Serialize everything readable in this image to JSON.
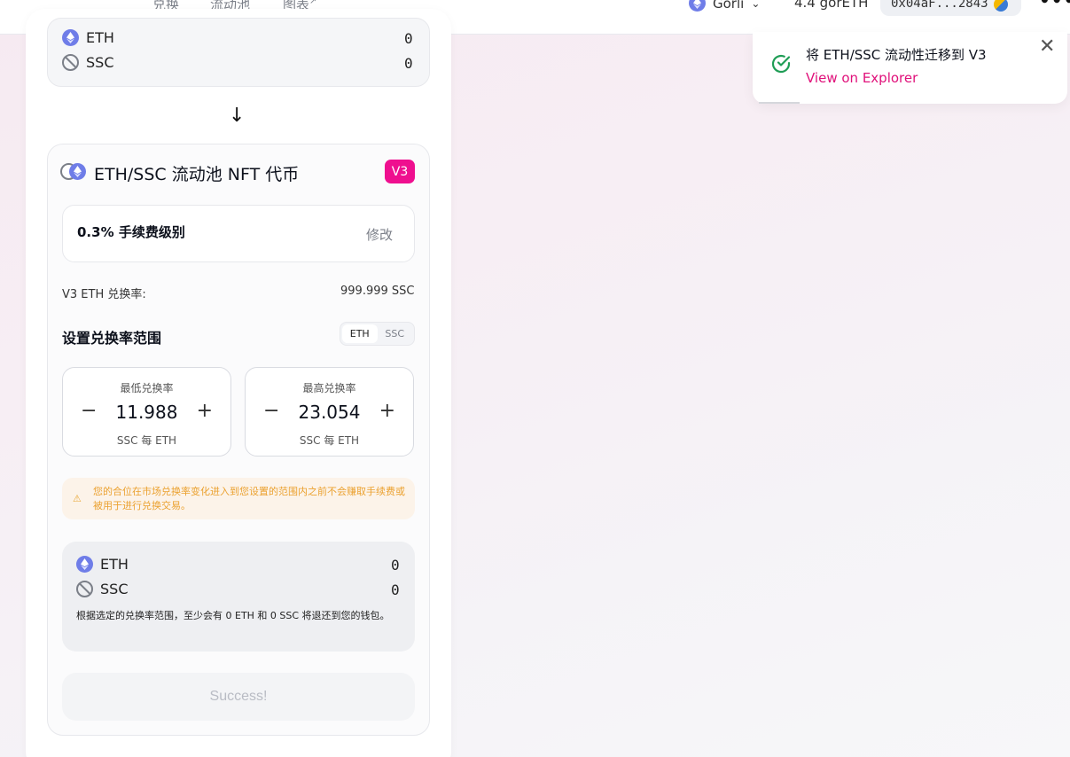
{
  "header": {
    "nav": [
      "兑换",
      "流动池",
      "图表"
    ],
    "network": "Görli",
    "balance": "4.4 görETH",
    "address": "0x04aF...2843"
  },
  "top_panel": {
    "tokens": [
      {
        "symbol": "ETH",
        "amount": "0"
      },
      {
        "symbol": "SSC",
        "amount": "0"
      }
    ]
  },
  "pool": {
    "title": "ETH/SSC 流动池 NFT 代币",
    "version_badge": "V3",
    "fee_tier": "0.3% 手续费级别",
    "edit_label": "修改",
    "rate_label": "V3 ETH 兑换率:",
    "rate_value": "999.999 SSC",
    "range_title": "设置兑换率范围",
    "toggle": [
      "ETH",
      "SSC"
    ],
    "min_price": {
      "title": "最低兑换率",
      "value": "11.988",
      "unit": "SSC 每 ETH"
    },
    "max_price": {
      "title": "最高兑换率",
      "value": "23.054",
      "unit": "SSC 每 ETH"
    },
    "warning": "您的合位在市场兑换率变化进入到您设置的范围内之前不会赚取手续费或被用于进行兑换交易。",
    "refund_tokens": [
      {
        "symbol": "ETH",
        "amount": "0"
      },
      {
        "symbol": "SSC",
        "amount": "0"
      }
    ],
    "refund_note": "根据选定的兑换率范围，至少会有 0 ETH 和 0 SSC 将退还到您的钱包。",
    "submit_label": "Success!"
  },
  "toast": {
    "title": "将 ETH/SSC 流动性迁移到 V3",
    "link": "View on Explorer"
  },
  "colors": {
    "accent": "#ef0f8f",
    "link": "#e0107a",
    "success": "#1f9d55",
    "warning": "#eba12f"
  }
}
